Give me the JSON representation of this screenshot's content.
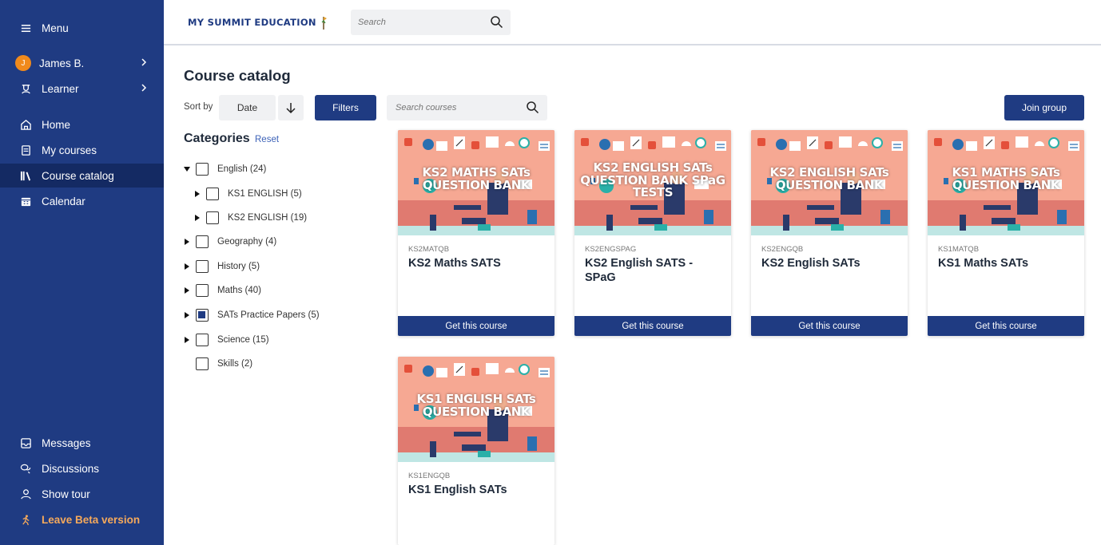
{
  "sidebar": {
    "menu": "Menu",
    "user": {
      "initial": "J",
      "name": "James B."
    },
    "role": "Learner",
    "nav": [
      {
        "label": "Home",
        "icon": "home-icon"
      },
      {
        "label": "My courses",
        "icon": "book-icon"
      },
      {
        "label": "Course catalog",
        "icon": "library-icon",
        "active": true
      },
      {
        "label": "Calendar",
        "icon": "calendar-icon"
      }
    ],
    "bottom": [
      {
        "label": "Messages",
        "icon": "message-icon"
      },
      {
        "label": "Discussions",
        "icon": "discussion-icon"
      },
      {
        "label": "Show tour",
        "icon": "tour-icon"
      },
      {
        "label": "Leave Beta version",
        "icon": "beta-icon"
      }
    ]
  },
  "header": {
    "logo_text": "MY SUMMIT EDUCATION",
    "search_placeholder": "Search"
  },
  "main": {
    "title": "Course catalog",
    "sort_label": "Sort by",
    "sort_value": "Date",
    "filters_label": "Filters",
    "search_placeholder": "Search courses",
    "join_label": "Join group"
  },
  "categories": {
    "title": "Categories",
    "reset": "Reset",
    "items": [
      {
        "label": "English (24)",
        "expanded": true,
        "checked": false
      },
      {
        "label": "KS1 ENGLISH (5)",
        "checked": false,
        "child": true
      },
      {
        "label": "KS2 ENGLISH (19)",
        "checked": false,
        "child": true
      },
      {
        "label": "Geography (4)",
        "checked": false
      },
      {
        "label": "History (5)",
        "checked": false
      },
      {
        "label": "Maths (40)",
        "checked": false
      },
      {
        "label": "SATs Practice Papers (5)",
        "checked": true
      },
      {
        "label": "Science (15)",
        "checked": false
      },
      {
        "label": "Skills (2)",
        "checked": false,
        "no_toggle": true
      }
    ]
  },
  "courses": [
    {
      "thumb_title": "KS2 MATHS SATs QUESTION BANK",
      "code": "KS2MATQB",
      "name": "KS2 Maths SATS",
      "button": "Get this course"
    },
    {
      "thumb_title": "KS2 ENGLISH SATs QUESTION BANK SPaG TESTS",
      "code": "KS2ENGSPAG",
      "name": "KS2 English SATS - SPaG",
      "button": "Get this course"
    },
    {
      "thumb_title": "KS2 ENGLISH SATs QUESTION BANK",
      "code": "KS2ENGQB",
      "name": "KS2 English SATs",
      "button": "Get this course"
    },
    {
      "thumb_title": "KS1 MATHS SATs QUESTION BANK",
      "code": "KS1MATQB",
      "name": "KS1 Maths SATs",
      "button": "Get this course"
    },
    {
      "thumb_title": "KS1 ENGLISH SATs QUESTION BANK",
      "code": "KS1ENGQB",
      "name": "KS1 English SATs",
      "button": "Get this course"
    }
  ],
  "colors": {
    "brand": "#1f3b82",
    "beta": "#f5a95b",
    "avatar": "#f08a1c"
  }
}
